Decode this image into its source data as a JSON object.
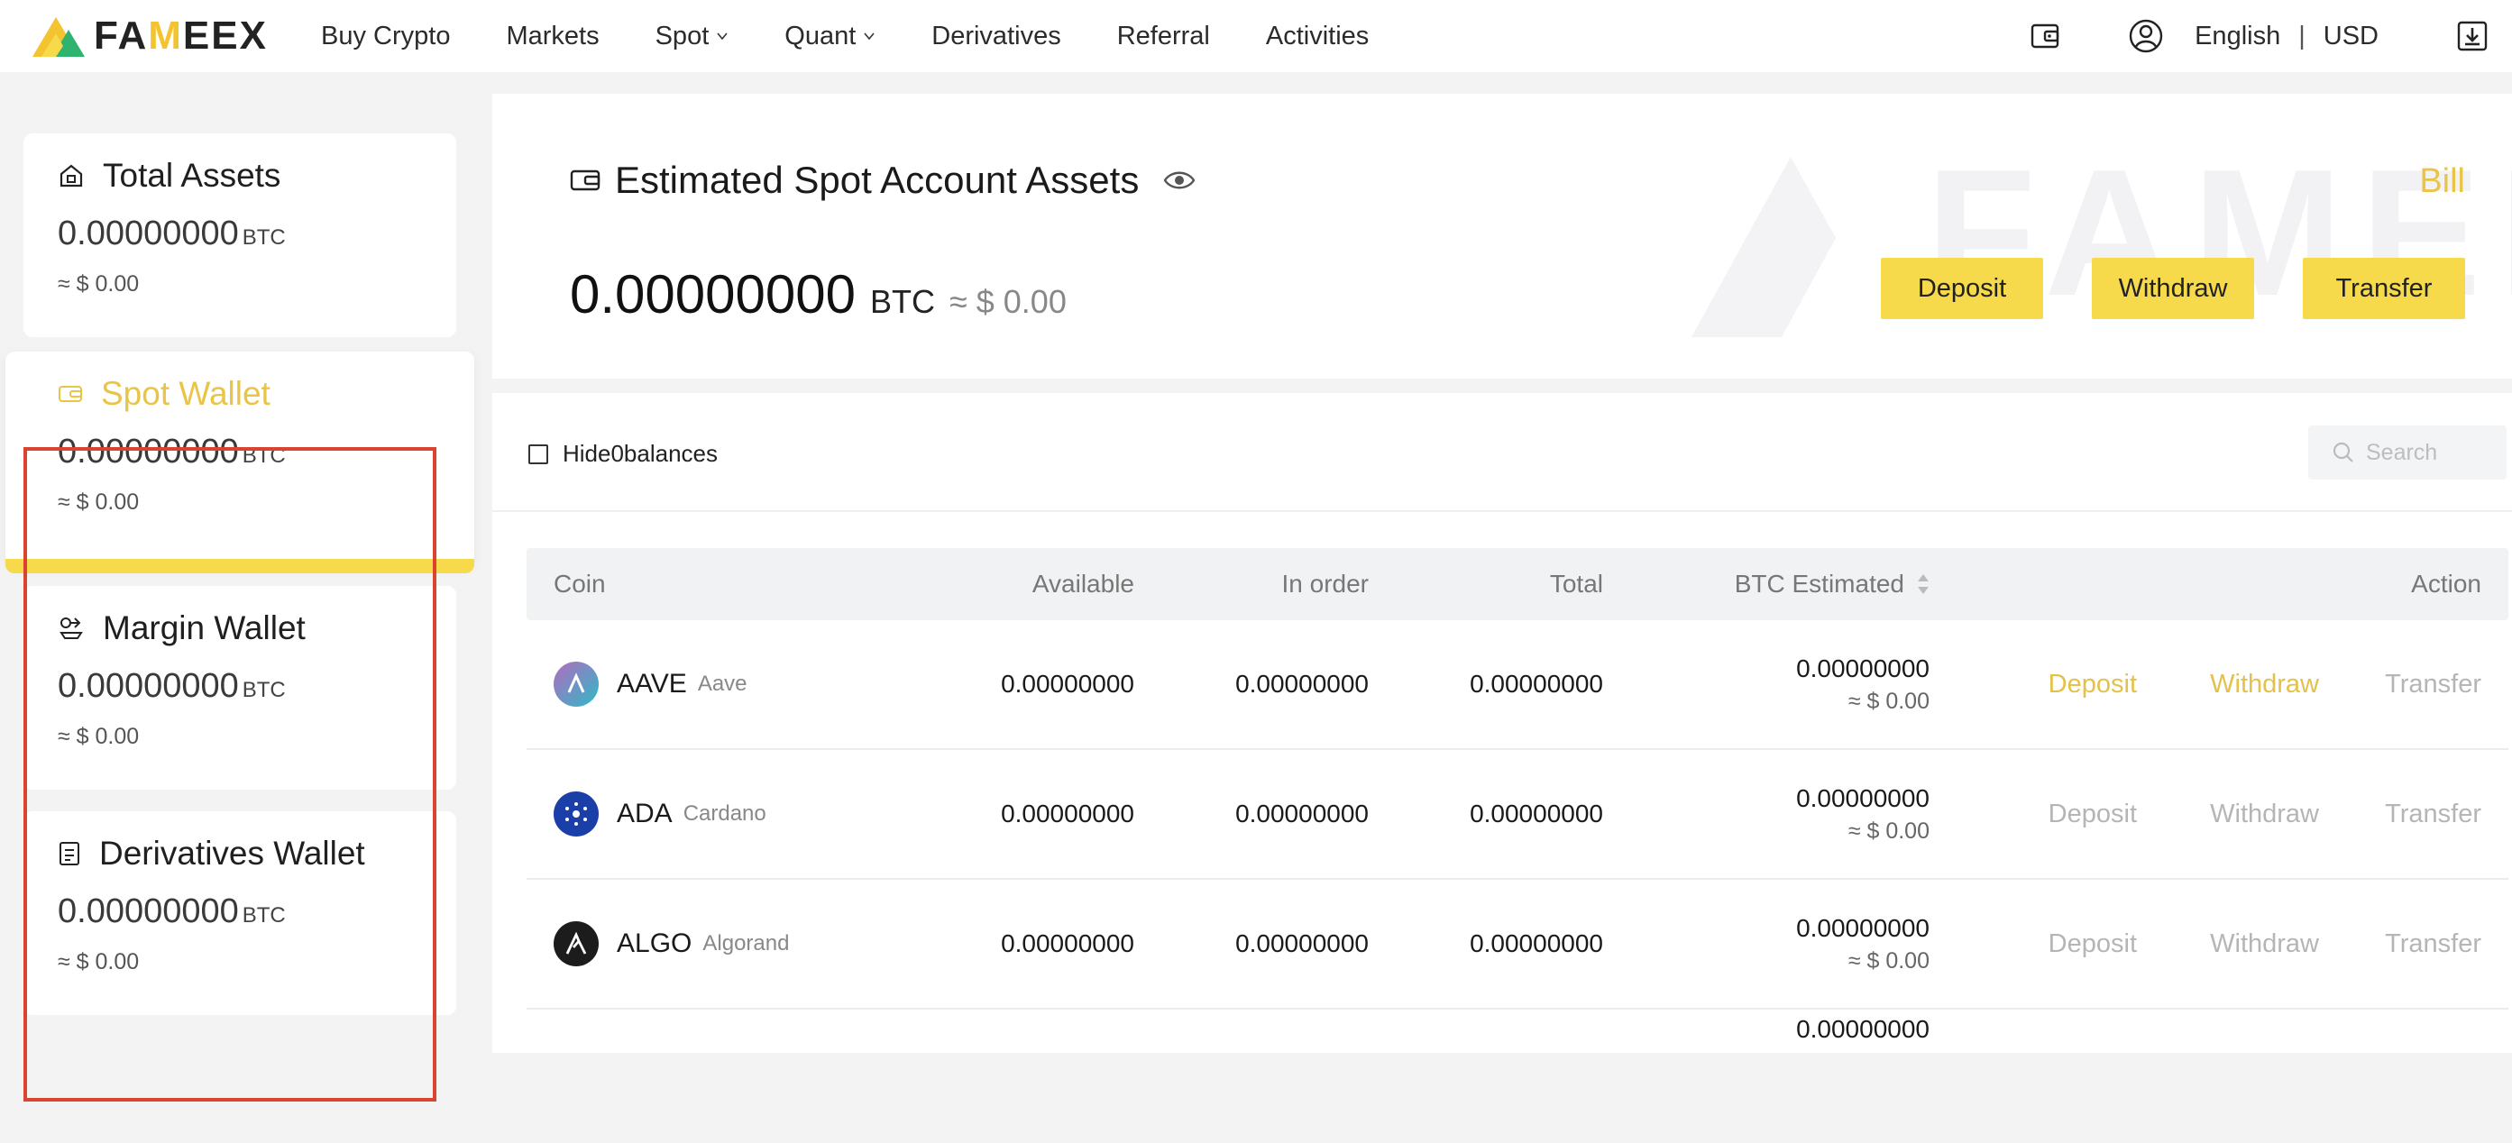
{
  "nav": {
    "logo": {
      "prefix": "FA",
      "highlight": "M",
      "suffix": "EEX"
    },
    "items": [
      {
        "label": "Buy Crypto",
        "dropdown": false
      },
      {
        "label": "Markets",
        "dropdown": false
      },
      {
        "label": "Spot",
        "dropdown": true
      },
      {
        "label": "Quant",
        "dropdown": true
      },
      {
        "label": "Derivatives",
        "dropdown": false
      },
      {
        "label": "Referral",
        "dropdown": false
      },
      {
        "label": "Activities",
        "dropdown": false
      }
    ],
    "language": "English",
    "separator": "|",
    "currency": "USD"
  },
  "sidebar": {
    "cards": [
      {
        "title": "Total Assets",
        "amount": "0.00000000",
        "unit": "BTC",
        "usd": "≈ $ 0.00",
        "icon": "home-icon"
      },
      {
        "title": "Spot Wallet",
        "amount": "0.00000000",
        "unit": "BTC",
        "usd": "≈ $ 0.00",
        "icon": "wallet-icon",
        "active": true
      },
      {
        "title": "Margin Wallet",
        "amount": "0.00000000",
        "unit": "BTC",
        "usd": "≈ $ 0.00",
        "icon": "margin-icon"
      },
      {
        "title": "Derivatives Wallet",
        "amount": "0.00000000",
        "unit": "BTC",
        "usd": "≈ $ 0.00",
        "icon": "derivatives-icon"
      }
    ]
  },
  "summary": {
    "title": "Estimated Spot Account Assets",
    "amount": "0.00000000",
    "unit": "BTC",
    "usd": "≈ $ 0.00",
    "bill": "Bill",
    "watermark": "FAMEEX",
    "buttons": {
      "deposit": "Deposit",
      "withdraw": "Withdraw",
      "transfer": "Transfer"
    }
  },
  "list": {
    "hide_zero_label": "Hide0balances",
    "search_placeholder": "Search",
    "columns": {
      "coin": "Coin",
      "available": "Available",
      "in_order": "In order",
      "total": "Total",
      "btc_estimated": "BTC Estimated",
      "action": "Action"
    },
    "rows": [
      {
        "symbol": "AAVE",
        "name": "Aave",
        "available": "0.00000000",
        "in_order": "0.00000000",
        "total": "0.00000000",
        "btc": "0.00000000",
        "usd": "≈ $ 0.00",
        "deposit": "Deposit",
        "withdraw": "Withdraw",
        "transfer": "Transfer",
        "actions_enabled": true,
        "icon_color": "#9b6fc7"
      },
      {
        "symbol": "ADA",
        "name": "Cardano",
        "available": "0.00000000",
        "in_order": "0.00000000",
        "total": "0.00000000",
        "btc": "0.00000000",
        "usd": "≈ $ 0.00",
        "deposit": "Deposit",
        "withdraw": "Withdraw",
        "transfer": "Transfer",
        "actions_enabled": false,
        "icon_color": "#1a3fa8"
      },
      {
        "symbol": "ALGO",
        "name": "Algorand",
        "available": "0.00000000",
        "in_order": "0.00000000",
        "total": "0.00000000",
        "btc": "0.00000000",
        "usd": "≈ $ 0.00",
        "deposit": "Deposit",
        "withdraw": "Withdraw",
        "transfer": "Transfer",
        "actions_enabled": false,
        "icon_color": "#1c1c1c"
      },
      {
        "symbol": "",
        "name": "",
        "available": "",
        "in_order": "",
        "total": "",
        "btc": "0.00000000",
        "usd": "",
        "deposit": "",
        "withdraw": "",
        "transfer": "",
        "actions_enabled": false,
        "icon_color": "#ffffff"
      }
    ]
  },
  "colors": {
    "accent": "#f7d94c",
    "accent_text": "#e3c14a",
    "highlight_border": "#d9432f"
  }
}
